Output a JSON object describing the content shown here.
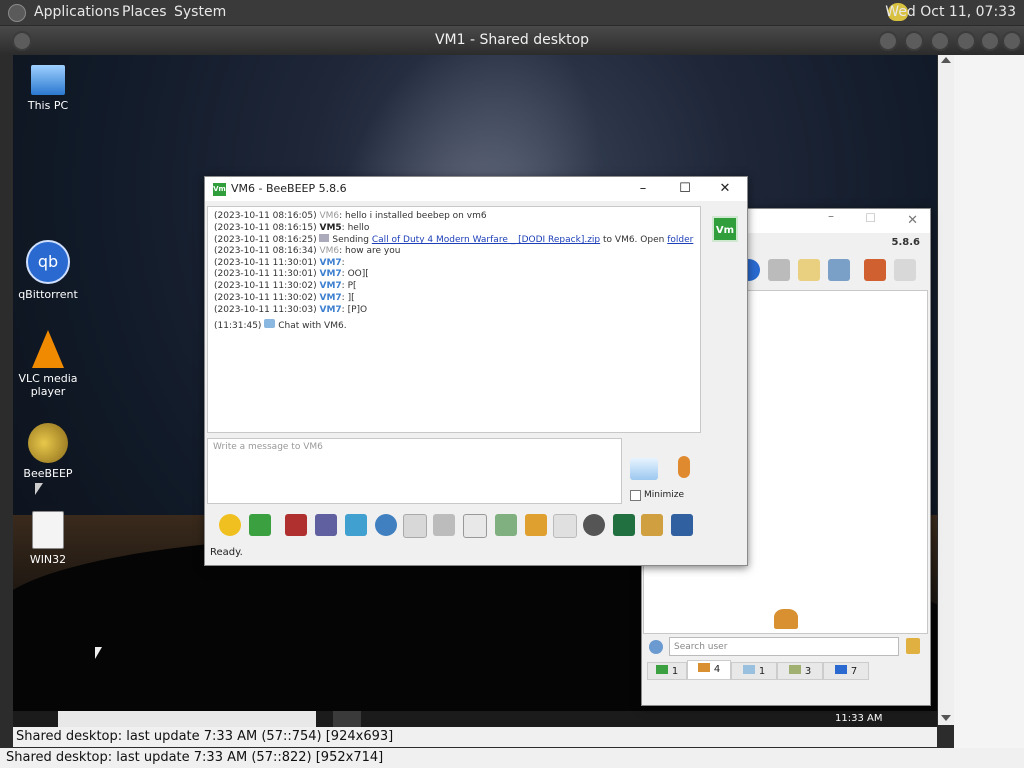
{
  "topbar": {
    "menus": [
      "Applications",
      "Places",
      "System"
    ],
    "clock": "Wed Oct 11, 07:33"
  },
  "vm": {
    "title": "VM1 - Shared desktop",
    "status_inner": "Shared desktop: last update 7:33 AM (57::754) [924x693]",
    "status_outer": "Shared desktop: last update 7:33 AM (57::822) [952x714]"
  },
  "desktop_icons": [
    {
      "label": "This PC",
      "icon": "computer-icon"
    },
    {
      "label": "qBittorrent",
      "icon": "qbittorrent-icon"
    },
    {
      "label": "VLC media player",
      "icon": "vlc-icon"
    },
    {
      "label": "BeeBEEP",
      "icon": "bee-icon"
    },
    {
      "label": "WIN32",
      "icon": "script-icon"
    }
  ],
  "taskbar": {
    "time": "11:33 AM"
  },
  "chat_window": {
    "title": "VM6 - BeeBEEP 5.8.6",
    "app_badge": "Vm",
    "messages": [
      {
        "ts": "(2023-10-11 08:16:05)",
        "user": "VM6",
        "text": "hello i installed beebep on vm6",
        "kind": "vm6"
      },
      {
        "ts": "(2023-10-11 08:16:15)",
        "user": "VM5",
        "text": "hello",
        "kind": "vm5"
      },
      {
        "ts": "(2023-10-11 08:16:25)",
        "pre": "Sending",
        "link": "Call of Duty 4 Modern Warfare _ [DODI Repack].zip",
        "mid": "to VM6. Open",
        "link2": "folder",
        "kind": "file"
      },
      {
        "ts": "(2023-10-11 08:16:34)",
        "user": "VM6",
        "text": "how are you",
        "kind": "vm6"
      },
      {
        "ts": "(2023-10-11 11:30:01)",
        "user": "VM7",
        "text": "",
        "kind": "vm7"
      },
      {
        "ts": "(2023-10-11 11:30:01)",
        "user": "VM7",
        "text": "OO][",
        "kind": "vm7"
      },
      {
        "ts": "(2023-10-11 11:30:02)",
        "user": "VM7",
        "text": "P[",
        "kind": "vm7"
      },
      {
        "ts": "(2023-10-11 11:30:02)",
        "user": "VM7",
        "text": "][",
        "kind": "vm7"
      },
      {
        "ts": "(2023-10-11 11:30:03)",
        "user": "VM7",
        "text": "[P]O",
        "kind": "vm7"
      },
      {
        "ts": "(11:31:45)",
        "text": "Chat with VM6.",
        "kind": "system"
      }
    ],
    "composer_placeholder": "Write a message to VM6",
    "minimize_label": "Minimize",
    "status": "Ready."
  },
  "main_window": {
    "version": "5.8.6",
    "search_placeholder": "Search user",
    "tabs": [
      {
        "icon": "chat-icon",
        "count": "1"
      },
      {
        "icon": "users-icon",
        "count": "4"
      },
      {
        "icon": "messages-icon",
        "count": "1"
      },
      {
        "icon": "groups-icon",
        "count": "3"
      },
      {
        "icon": "share-icon",
        "count": "7"
      }
    ]
  }
}
